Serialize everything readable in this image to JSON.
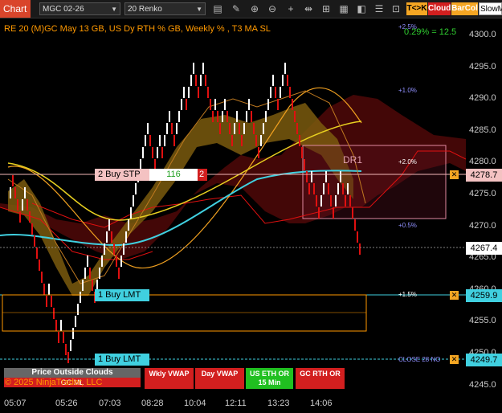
{
  "toolbar": {
    "chart_tab": "Chart",
    "instrument": "MGC 02-26",
    "bar_type": "20 Renko",
    "toggle_tk": "T<>K",
    "toggle_cloud": "Cloud",
    "toggle_barcol": "BarCol",
    "slowma_input": "SlowM"
  },
  "chart": {
    "title": "RE 20  (M)GC May 13 GB, US Dy RTH % GB, Weekly % , T3 MA SL",
    "top_right_stat": "0.29% = 12.5",
    "copyright": "© 2025 NinjaTrader, LLC",
    "zone_label": "DR1",
    "price_ticks": [
      "4300.0",
      "4295.0",
      "4290.0",
      "4285.0",
      "4280.0",
      "4275.0",
      "4270.0",
      "4265.0",
      "4260.0",
      "4255.0",
      "4250.0",
      "4245.0"
    ],
    "price_boxes": {
      "stop": "4278.7",
      "last": "4267.4",
      "limit1": "4259.9",
      "limit2": "4249.7"
    },
    "time_ticks": [
      "05:07",
      "05:26",
      "07:03",
      "08:28",
      "10:04",
      "12:11",
      "13:23",
      "14:06"
    ],
    "pct_labels": [
      "+2.5%",
      "+1.0%",
      "+2.0%",
      "+0.5%",
      "+1.5%",
      "CLOSE 28 NO"
    ]
  },
  "orders": {
    "buy_stop": {
      "label": "2 Buy STP",
      "qty": "116",
      "count": "2"
    },
    "buy_limit_1": {
      "label": "1 Buy LMT"
    },
    "buy_limit_2": {
      "label": "1 Buy LMT"
    }
  },
  "bottom_panel": {
    "price_clouds": "Price Outside Clouds",
    "gc_ml": "GC ML",
    "wkly_vwap": "Wkly VWAP",
    "day_vwap": "Day VWAP",
    "us_eth": "US ETH OR 15 Min",
    "gc_rth": "GC RTH OR"
  },
  "colors": {
    "background": "#000000",
    "bull_brick": "#ffffff",
    "bear_brick": "#e01010",
    "cloud_gold": "#8a6a10",
    "cloud_red": "#5a0a0a",
    "accent_orange": "#ff9900",
    "cyan_ma": "#40d0e0",
    "yellow_ma": "#e8d020",
    "chart_tab": "#d9452b"
  },
  "icons": [
    "pencil-icon",
    "zoom-in-icon",
    "zoom-out-icon",
    "crosshair-icon",
    "bar-spacing-icon",
    "drawing-tools-icon",
    "data-box-icon",
    "chart-trader-icon",
    "properties-icon"
  ]
}
